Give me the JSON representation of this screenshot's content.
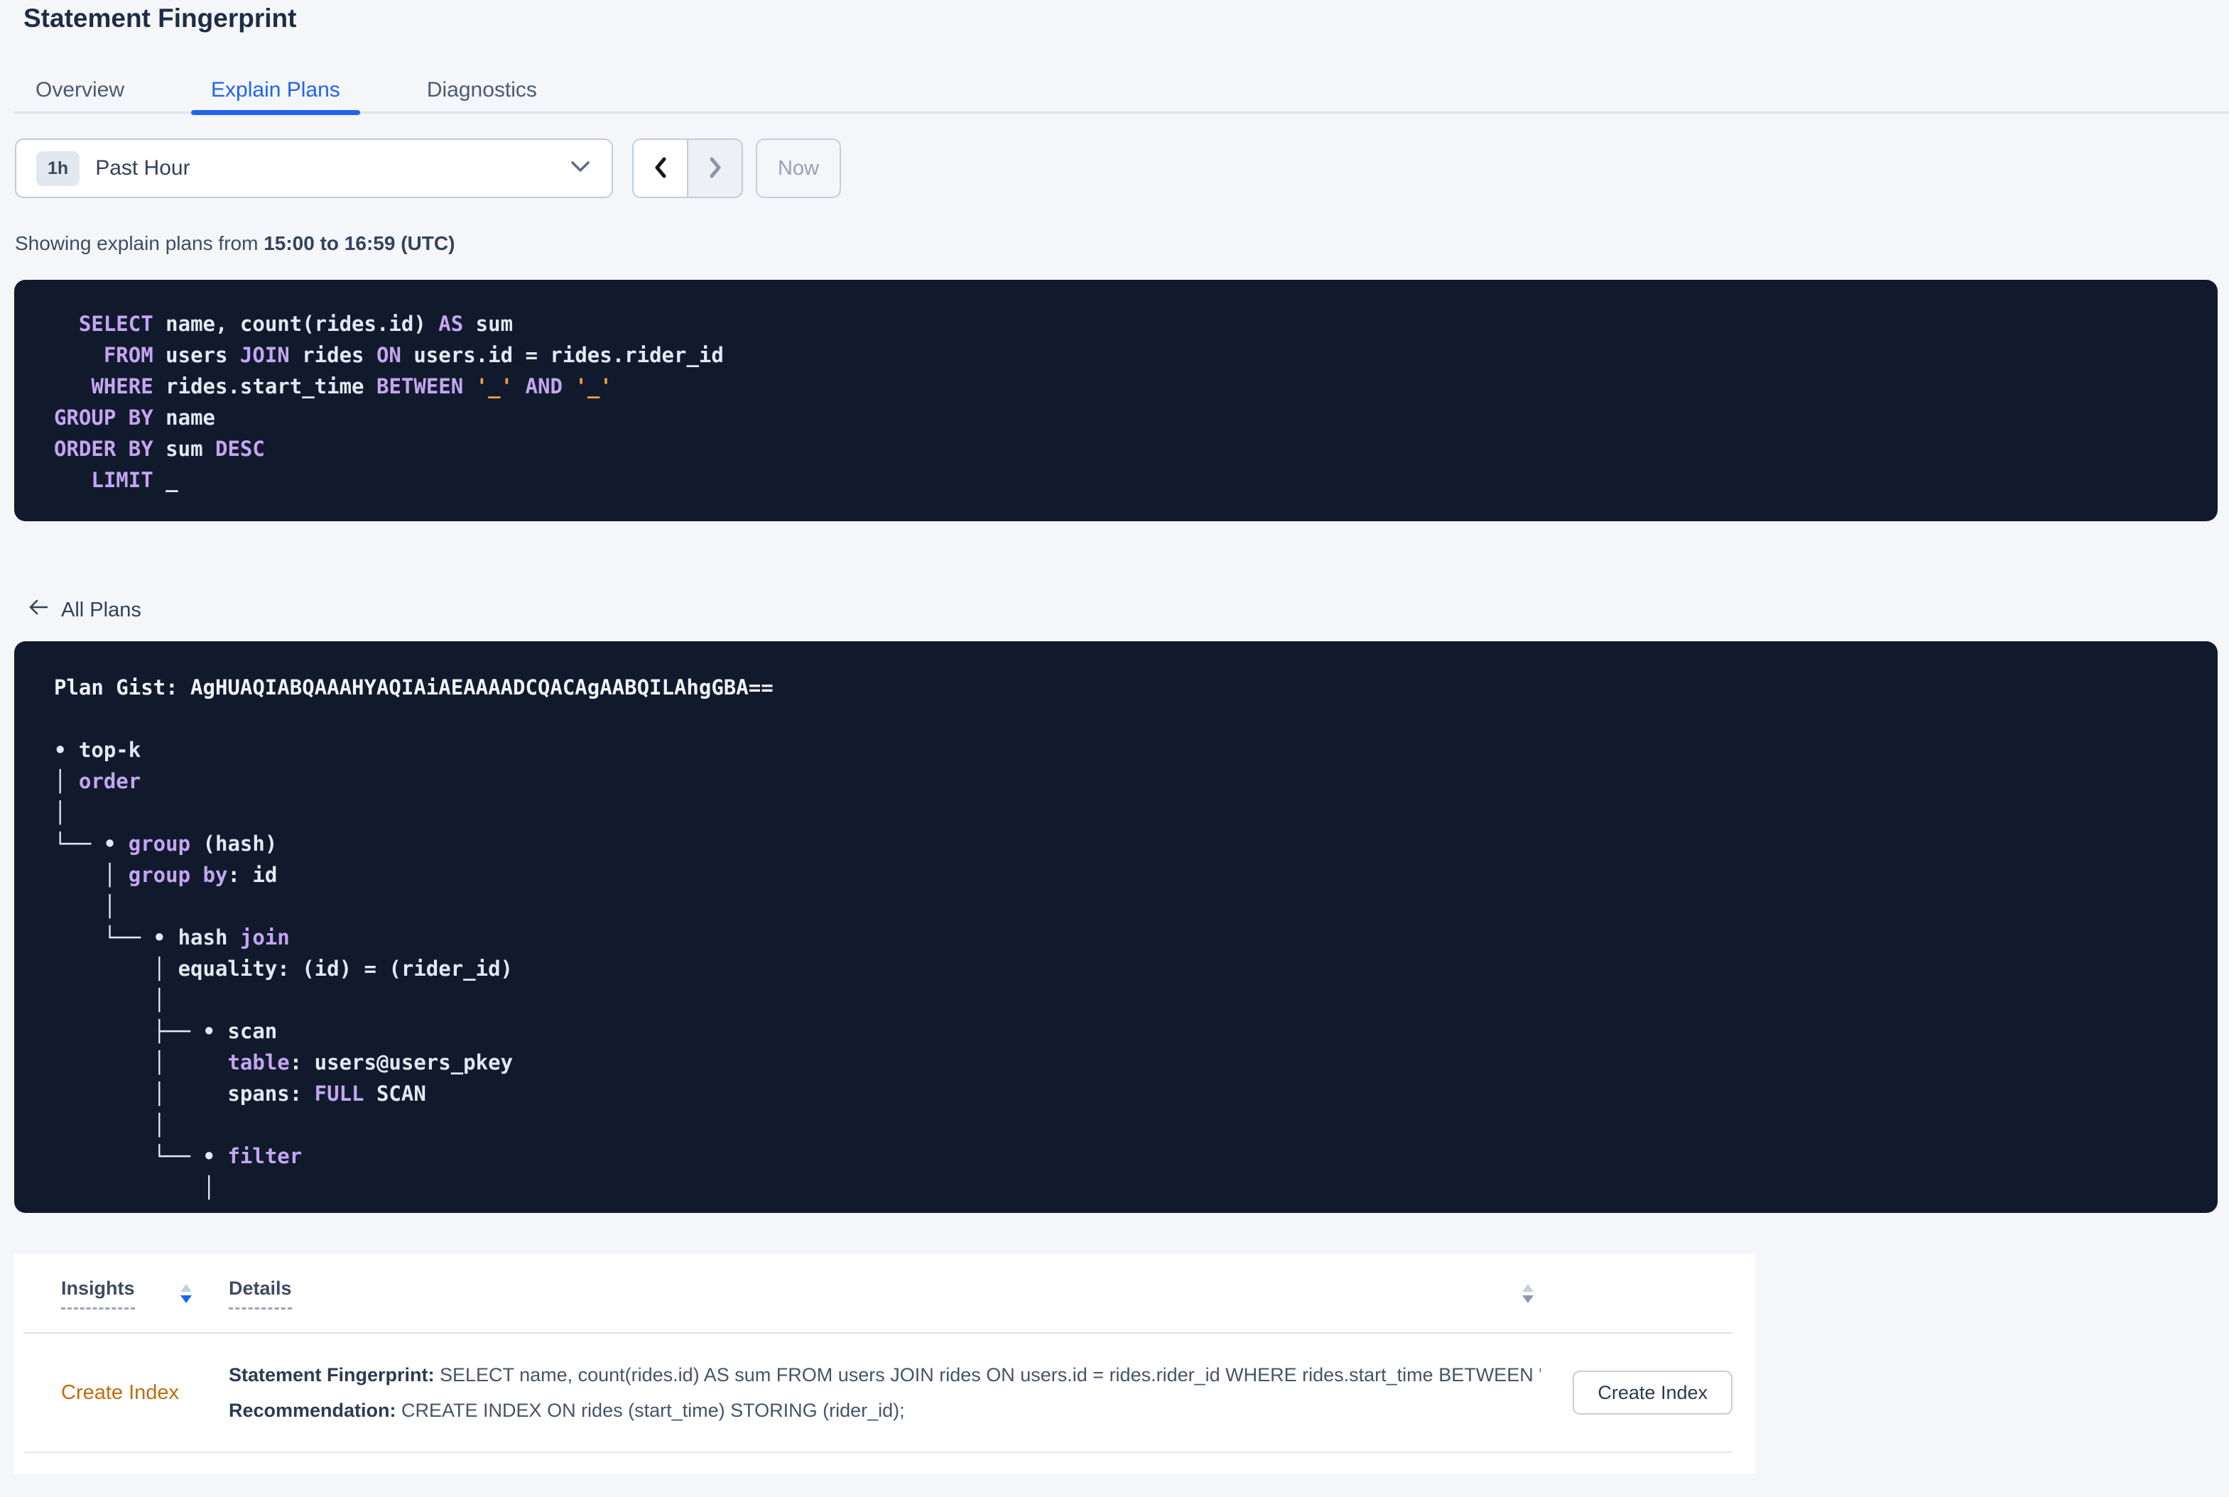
{
  "header": {
    "title": "Statement Fingerprint"
  },
  "tabs": [
    {
      "label": "Overview",
      "active": false
    },
    {
      "label": "Explain Plans",
      "active": true
    },
    {
      "label": "Diagnostics",
      "active": false
    }
  ],
  "time_picker": {
    "badge": "1h",
    "label": "Past Hour"
  },
  "now_label": "Now",
  "showing": {
    "prefix": "Showing explain plans from ",
    "range": "15:00 to 16:59 (UTC)"
  },
  "back_link_label": "All Plans",
  "sql": {
    "lines": [
      [
        {
          "t": "  "
        },
        {
          "t": "SELECT",
          "c": "kw"
        },
        {
          "t": " name, count(rides.id) "
        },
        {
          "t": "AS",
          "c": "kw"
        },
        {
          "t": " sum"
        }
      ],
      [
        {
          "t": "    "
        },
        {
          "t": "FROM",
          "c": "kw"
        },
        {
          "t": " users "
        },
        {
          "t": "JOIN",
          "c": "kw"
        },
        {
          "t": " rides "
        },
        {
          "t": "ON",
          "c": "kw"
        },
        {
          "t": " users.id = rides.rider_id"
        }
      ],
      [
        {
          "t": "   "
        },
        {
          "t": "WHERE",
          "c": "kw"
        },
        {
          "t": " rides.start_time "
        },
        {
          "t": "BETWEEN",
          "c": "kw"
        },
        {
          "t": " "
        },
        {
          "t": "'_'",
          "c": "str"
        },
        {
          "t": " "
        },
        {
          "t": "AND",
          "c": "kw"
        },
        {
          "t": " "
        },
        {
          "t": "'_'",
          "c": "str"
        }
      ],
      [
        {
          "t": "GROUP BY",
          "c": "kw"
        },
        {
          "t": " name"
        }
      ],
      [
        {
          "t": "ORDER BY",
          "c": "kw"
        },
        {
          "t": " sum "
        },
        {
          "t": "DESC",
          "c": "kw"
        }
      ],
      [
        {
          "t": "   "
        },
        {
          "t": "LIMIT",
          "c": "kw"
        },
        {
          "t": " _"
        }
      ]
    ]
  },
  "plan": {
    "lines": [
      [
        {
          "t": "Plan Gist: AgHUAQIABQAAAHYAQIAiAEAAAADCQACAgAABQILAhgGBA==",
          "c": "b"
        }
      ],
      [],
      [
        {
          "t": "• top-k"
        }
      ],
      [
        {
          "t": "│ "
        },
        {
          "t": "order",
          "c": "kw"
        }
      ],
      [
        {
          "t": "│"
        }
      ],
      [
        {
          "t": "└── • "
        },
        {
          "t": "group",
          "c": "kw"
        },
        {
          "t": " (hash)"
        }
      ],
      [
        {
          "t": "    │ "
        },
        {
          "t": "group by",
          "c": "kw"
        },
        {
          "t": ": id"
        }
      ],
      [
        {
          "t": "    │"
        }
      ],
      [
        {
          "t": "    └── • hash "
        },
        {
          "t": "join",
          "c": "kw"
        }
      ],
      [
        {
          "t": "        │ equality: (id) = (rider_id)"
        }
      ],
      [
        {
          "t": "        │"
        }
      ],
      [
        {
          "t": "        ├── • scan"
        }
      ],
      [
        {
          "t": "        │     "
        },
        {
          "t": "table",
          "c": "kw"
        },
        {
          "t": ": users@users_pkey"
        }
      ],
      [
        {
          "t": "        │     spans: "
        },
        {
          "t": "FULL",
          "c": "kw"
        },
        {
          "t": " SCAN"
        }
      ],
      [
        {
          "t": "        │"
        }
      ],
      [
        {
          "t": "        └── • "
        },
        {
          "t": "filter",
          "c": "kw"
        }
      ],
      [
        {
          "t": "            │"
        }
      ]
    ]
  },
  "insights_table": {
    "columns": [
      "Insights",
      "Details"
    ],
    "rows": [
      {
        "insight": "Create Index",
        "details": [
          {
            "label": "Statement Fingerprint:",
            "text": " SELECT name, count(rides.id) AS sum FROM users JOIN rides ON users.id = rides.rider_id WHERE rides.start_time BETWEEN '_…"
          },
          {
            "label": "Recommendation:",
            "text": " CREATE INDEX ON rides (start_time) STORING (rider_id);"
          }
        ],
        "action": "Create Index"
      }
    ]
  },
  "colors": {
    "accent_blue": "#2163f0",
    "code_panel_bg": "#111a2d",
    "code_keyword_purple": "#c3a6f0",
    "code_literal_orange": "#f0a13c",
    "insight_amber": "#c06c10",
    "page_bg": "#f4f6fa"
  }
}
